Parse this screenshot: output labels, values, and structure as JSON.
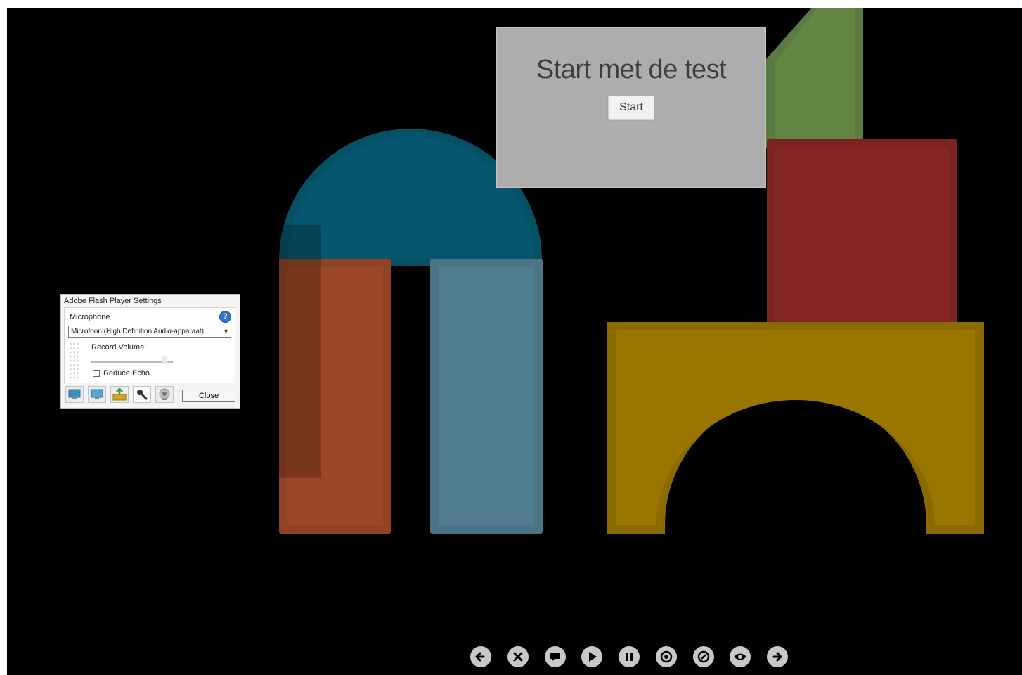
{
  "start_dialog": {
    "title": "Start met de test",
    "button_label": "Start"
  },
  "flash_settings": {
    "title": "Adobe Flash Player Settings",
    "section_label": "Microphone",
    "help_label": "?",
    "selected_device": "Microfoon (High Definition Audio-apparaat)",
    "record_volume_label": "Record Volume:",
    "record_volume_fraction": 0.9,
    "reduce_echo_label": "Reduce Echo",
    "reduce_echo_checked": false,
    "close_label": "Close",
    "tabs": [
      {
        "icon": "privacy-monitor-icon",
        "selected": false
      },
      {
        "icon": "display-monitor-icon",
        "selected": false
      },
      {
        "icon": "local-storage-icon",
        "selected": false
      },
      {
        "icon": "microphone-icon",
        "selected": true
      },
      {
        "icon": "camera-icon",
        "selected": false
      }
    ]
  },
  "scene": {
    "background": "#000000",
    "colors": {
      "arch_teal": "#045166",
      "pillar_orange": "#904224",
      "pillar_steel": "#4a7385",
      "triangle_green": "#5a7a3f",
      "square_red": "#7a2321",
      "bridge_gold": "#8a6b00"
    }
  },
  "toolbar": {
    "controls": [
      {
        "icon": "arrow-left-icon"
      },
      {
        "icon": "close-x-icon"
      },
      {
        "icon": "comment-icon"
      },
      {
        "icon": "play-icon"
      },
      {
        "icon": "pause-icon"
      },
      {
        "icon": "record-icon"
      },
      {
        "icon": "replay-icon"
      },
      {
        "icon": "eye-icon"
      },
      {
        "icon": "arrow-right-icon"
      }
    ]
  }
}
